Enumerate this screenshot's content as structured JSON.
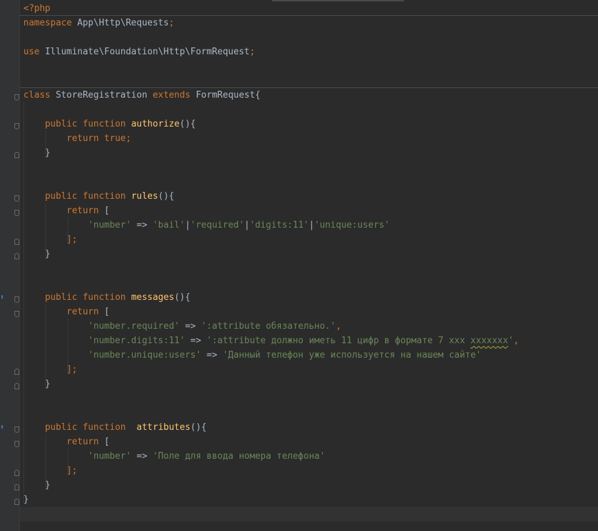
{
  "code": {
    "php_open": "<?php",
    "namespace": {
      "keyword": "namespace",
      "name": "App\\Http\\Requests",
      "semi": ";"
    },
    "use": {
      "keyword": "use",
      "name": "Illuminate\\Foundation\\Http\\FormRequest",
      "semi": ";"
    },
    "class_decl": {
      "keyword_class": "class",
      "name": "StoreRegistration",
      "keyword_extends": "extends",
      "parent": "FormRequest",
      "brace": "{"
    },
    "authorize": {
      "keyword_public": "public",
      "keyword_function": "function",
      "name": "authorize",
      "parens": "(){",
      "return_keyword": "return",
      "return_value": "true",
      "semi": ";",
      "close": "}"
    },
    "rules": {
      "keyword_public": "public",
      "keyword_function": "function",
      "name": "rules",
      "parens": "(){",
      "return_keyword": "return",
      "open_bracket": "[",
      "entry_key": "'number'",
      "arrow": "=>",
      "parts": [
        "'bail'",
        "|",
        "'required'",
        "|",
        "'digits:11'",
        "|",
        "'unique:users'"
      ],
      "close_bracket": "];",
      "close": "}"
    },
    "messages": {
      "keyword_public": "public",
      "keyword_function": "function",
      "name": "messages",
      "parens": "(){",
      "return_keyword": "return",
      "open_bracket": "[",
      "entries": [
        {
          "key": "'number.required'",
          "arrow": "=>",
          "value": "':attribute обязательно.'",
          "comma": ","
        },
        {
          "key": "'number.digits:11'",
          "arrow": "=>",
          "value_prefix": "':attribute должно иметь 11 цифр в формате 7 xxx ",
          "value_typo": "xxxxxxx",
          "value_suffix": "'",
          "comma": ","
        },
        {
          "key": "'number.unique:users'",
          "arrow": "=>",
          "value": "'Данный телефон уже используется на нашем сайте'",
          "comma": ""
        }
      ],
      "close_bracket": "];",
      "close": "}"
    },
    "attributes": {
      "keyword_public": "public",
      "keyword_function": "function",
      "name": "attributes",
      "parens": "(){",
      "return_keyword": "return",
      "open_bracket": "[",
      "entry_key": "'number'",
      "arrow": "=>",
      "entry_value": "'Поле для ввода номера телефона'",
      "close_bracket": "];",
      "close": "}"
    },
    "class_close": "}"
  },
  "gutter_icons": [
    "override-marker-icon",
    "override-marker-icon"
  ],
  "colors": {
    "background": "#2b2b2b",
    "gutter": "#313335",
    "keyword": "#cc7832",
    "function_name": "#ffc66d",
    "string": "#6a8759",
    "text": "#a9b7c6"
  }
}
